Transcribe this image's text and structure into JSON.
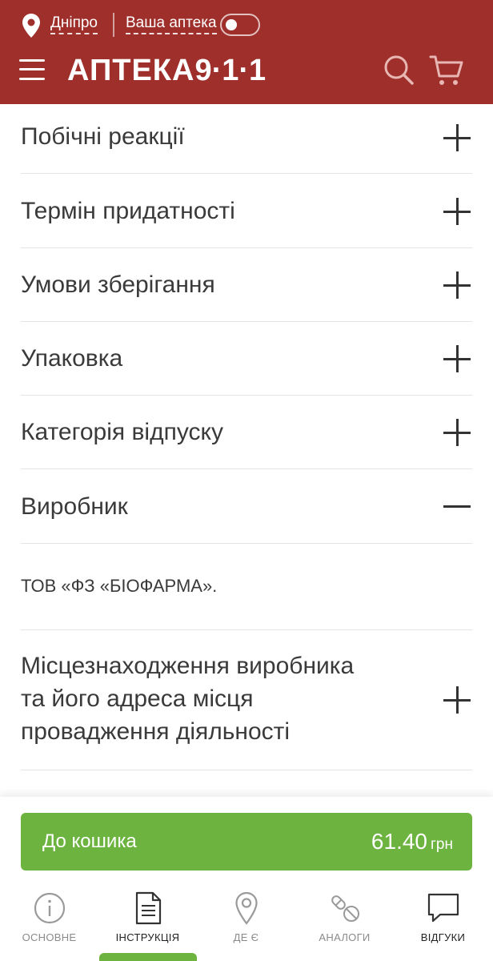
{
  "header": {
    "city": "Дніпро",
    "pharmacy_label": "Ваша аптека",
    "logo_text": "АПТЕКА",
    "logo_number": "9·1·1",
    "toggle_on": false
  },
  "accordion": [
    {
      "label": "Побічні реакції",
      "expanded": false
    },
    {
      "label": "Термін придатності",
      "expanded": false
    },
    {
      "label": "Умови зберігання",
      "expanded": false
    },
    {
      "label": "Упаковка",
      "expanded": false
    },
    {
      "label": "Категорія відпуску",
      "expanded": false
    },
    {
      "label": "Виробник",
      "expanded": true,
      "content": "ТОВ «ФЗ «БІОФАРМА»."
    },
    {
      "label_lines": [
        "Місцезнаходження виробника",
        "та його адреса місця",
        "провадження діяльності"
      ],
      "expanded": false
    }
  ],
  "cart": {
    "label": "До кошика",
    "price": "61.40",
    "currency": "грн"
  },
  "nav": [
    {
      "label": "ОСНОВНЕ",
      "icon": "info-icon"
    },
    {
      "label": "ІНСТРУКЦІЯ",
      "icon": "document-icon",
      "active": true
    },
    {
      "label": "ДЕ Є",
      "icon": "location-icon"
    },
    {
      "label": "АНАЛОГИ",
      "icon": "pills-icon"
    },
    {
      "label": "ВІДГУКИ",
      "icon": "chat-icon"
    }
  ],
  "colors": {
    "header": "#9e2f2b",
    "accent": "#6cb33f",
    "text": "#333333"
  }
}
